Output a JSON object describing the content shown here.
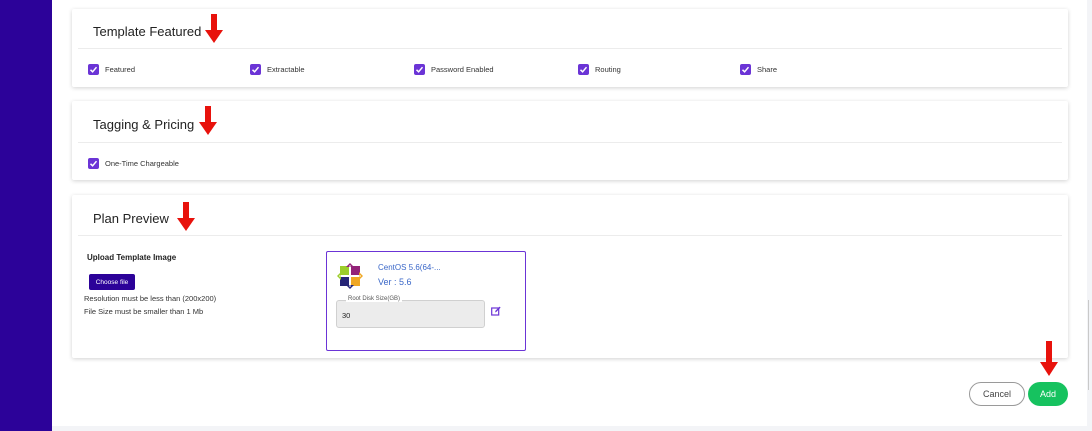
{
  "sections": {
    "template_featured": {
      "title": "Template Featured",
      "checkboxes": [
        "Featured",
        "Extractable",
        "Password Enabled",
        "Routing",
        "Share"
      ]
    },
    "tagging_pricing": {
      "title": "Tagging & Pricing",
      "checkboxes": [
        "One-Time Chargeable"
      ]
    },
    "plan_preview": {
      "title": "Plan Preview",
      "upload_title": "Upload Template Image",
      "choose_file_label": "Choose file",
      "resolution_note": "Resolution must be less than (200x200)",
      "size_note": "File Size must be smaller than 1 Mb",
      "preview": {
        "os_name": "CentOS 5.6(64-...",
        "version": "Ver : 5.6",
        "disk_label": "Root Disk Size(GB)",
        "disk_value": "30"
      }
    }
  },
  "actions": {
    "cancel_label": "Cancel",
    "add_label": "Add"
  },
  "colors": {
    "accent": "#6b34d6",
    "sidebar": "#2c0299",
    "add": "#16c25f",
    "arrow": "#e8120c",
    "link": "#3a67c8"
  },
  "icons": [
    "check-icon",
    "red-arrow-down-icon",
    "centos-logo-icon",
    "edit-icon"
  ]
}
